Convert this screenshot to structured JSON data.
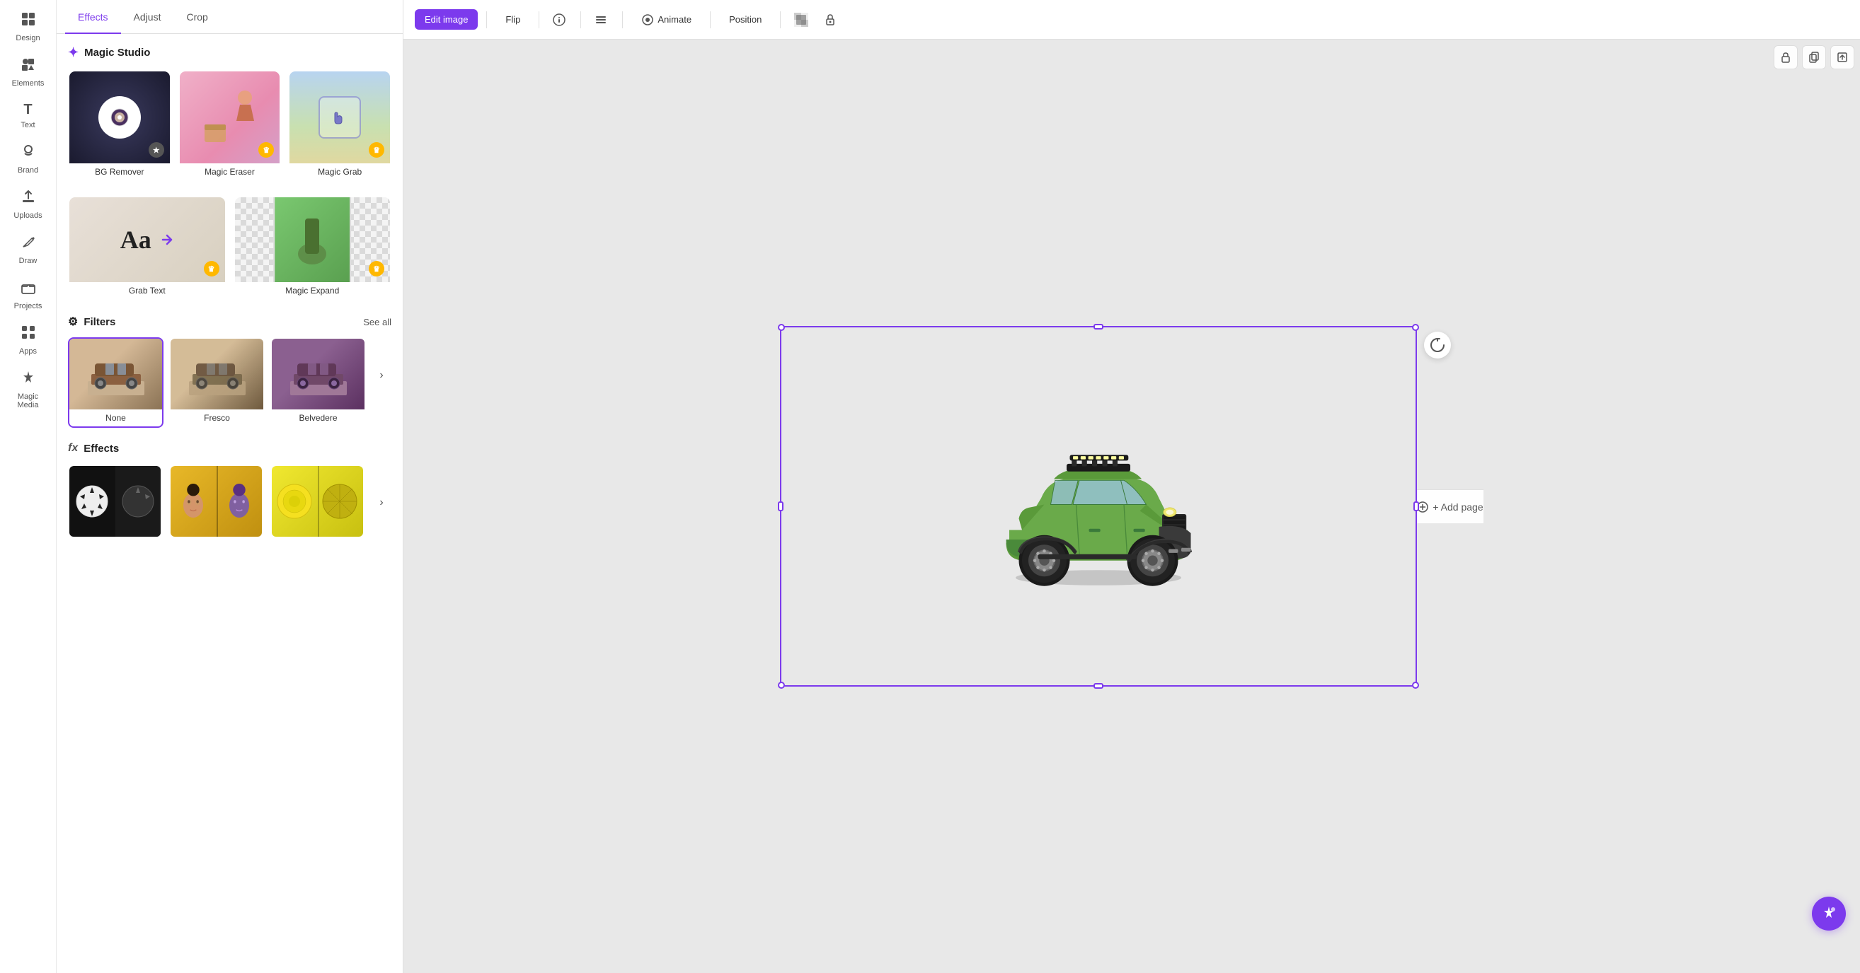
{
  "sidebar": {
    "items": [
      {
        "id": "design",
        "label": "Design",
        "icon": "⊞"
      },
      {
        "id": "elements",
        "label": "Elements",
        "icon": "✦"
      },
      {
        "id": "text",
        "label": "Text",
        "icon": "T"
      },
      {
        "id": "brand",
        "label": "Brand",
        "icon": "◈"
      },
      {
        "id": "uploads",
        "label": "Uploads",
        "icon": "↑"
      },
      {
        "id": "draw",
        "label": "Draw",
        "icon": "✏"
      },
      {
        "id": "projects",
        "label": "Projects",
        "icon": "⊡"
      },
      {
        "id": "apps",
        "label": "Apps",
        "icon": "⊞"
      },
      {
        "id": "magic-media",
        "label": "Magic Media",
        "icon": "✦"
      }
    ],
    "active": "design"
  },
  "panel": {
    "tabs": [
      {
        "id": "effects",
        "label": "Effects",
        "active": true
      },
      {
        "id": "adjust",
        "label": "Adjust",
        "active": false
      },
      {
        "id": "crop",
        "label": "Crop",
        "active": false
      }
    ],
    "magic_studio": {
      "title": "Magic Studio",
      "icon": "✦",
      "items": [
        {
          "id": "bg-remover",
          "label": "BG Remover",
          "badge": "star",
          "badgeText": "★"
        },
        {
          "id": "magic-eraser",
          "label": "Magic Eraser",
          "badge": "crown",
          "badgeText": "♛"
        },
        {
          "id": "magic-grab",
          "label": "Magic Grab",
          "badge": "crown",
          "badgeText": "♛"
        },
        {
          "id": "grab-text",
          "label": "Grab Text",
          "badge": "crown",
          "badgeText": "♛"
        },
        {
          "id": "magic-expand",
          "label": "Magic Expand",
          "badge": "crown",
          "badgeText": "♛"
        }
      ]
    },
    "filters": {
      "title": "Filters",
      "see_all": "See all",
      "items": [
        {
          "id": "none",
          "label": "None",
          "selected": true
        },
        {
          "id": "fresco",
          "label": "Fresco",
          "selected": false
        },
        {
          "id": "belvedere",
          "label": "Belvedere",
          "selected": false
        }
      ]
    },
    "effects": {
      "title": "Effects",
      "icon": "fx",
      "items": [
        {
          "id": "soccer",
          "label": ""
        },
        {
          "id": "head",
          "label": ""
        },
        {
          "id": "lemon",
          "label": ""
        }
      ]
    }
  },
  "toolbar": {
    "edit_image": "Edit image",
    "flip": "Flip",
    "animate": "Animate",
    "position": "Position"
  },
  "canvas": {
    "add_page": "+ Add page"
  }
}
